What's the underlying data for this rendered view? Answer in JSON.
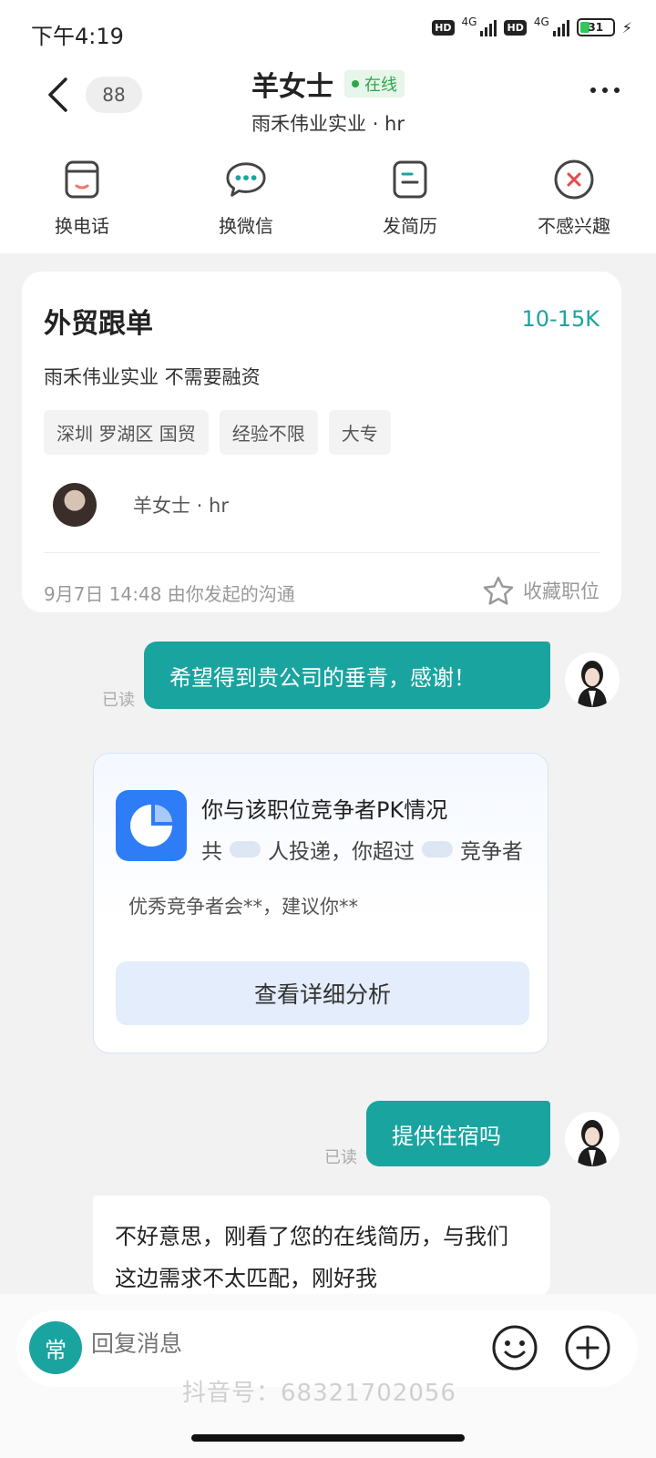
{
  "status_bar": {
    "time": "下午4:19",
    "network_labels": [
      "4G",
      "4G"
    ],
    "hd_labels": [
      "HD",
      "HD"
    ],
    "battery": "31",
    "battery_level": 0.31
  },
  "header": {
    "back_icon": "chevron-left-icon",
    "unread_count": "88",
    "name": "羊女士",
    "online_status": "在线",
    "subtitle": "雨禾伟业实业 · hr",
    "more_icon": "more-horizontal-icon"
  },
  "actions": [
    {
      "label": "换电话",
      "icon": "phone-icon"
    },
    {
      "label": "换微信",
      "icon": "wechat-icon"
    },
    {
      "label": "发简历",
      "icon": "resume-icon"
    },
    {
      "label": "不感兴趣",
      "icon": "close-circle-icon"
    }
  ],
  "job": {
    "title": "外贸跟单",
    "salary": "10-15K",
    "company": "雨禾伟业实业 不需要融资",
    "tags": [
      "深圳 罗湖区 国贸",
      "经验不限",
      "大专"
    ],
    "recruiter": "羊女士 · hr",
    "started": "9月7日 14:48 由你发起的沟通",
    "favorite_label": "收藏职位"
  },
  "messages": {
    "msg1": "希望得到贵公司的垂青，感谢！",
    "msg1_status": "已读",
    "msg2": "提供住宿吗",
    "msg2_status": "已读",
    "reply": "不好意思，刚看了您的在线简历，与我们这边需求不太匹配，刚好我"
  },
  "pk_card": {
    "title": "你与该职位竞争者PK情况",
    "line_prefix": "共",
    "line_mid": "人投递，你超过",
    "line_suffix": "竞争者",
    "desc": "优秀竞争者会**，建议你**",
    "button": "查看详细分析"
  },
  "input": {
    "common_label": "常",
    "placeholder": "回复消息",
    "emoji_icon": "smile-icon",
    "plus_icon": "plus-circle-icon"
  },
  "watermark": "抖音号：68321702056",
  "colors": {
    "accent": "#1aa4a0",
    "online": "#2ea84a",
    "pk_blue": "#2f7df6"
  }
}
